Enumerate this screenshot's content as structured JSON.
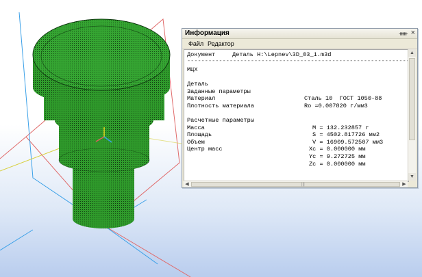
{
  "window": {
    "title": "Информация",
    "pin_icon": "pin-icon",
    "close_icon": "close-icon"
  },
  "menu": {
    "file": "Файл",
    "edit": "Редактор"
  },
  "document": {
    "label": "Документ",
    "value": "Деталь H:\\Lepnev\\3D_03_1.m3d",
    "separator": "------------------------------------------------------------------"
  },
  "section_mch": "МЦХ",
  "part": {
    "heading": "Деталь",
    "given_params": "Заданные параметры",
    "material_label": "Материал",
    "material_value": "Сталь 10  ГОСТ 1050-88",
    "density_label": "Плотность материала",
    "density_value": "Ro =0.007820 г/мм3"
  },
  "calc": {
    "heading": "Расчетные параметры",
    "mass_label": "Масса",
    "mass_value": "M = 132.232857 г",
    "area_label": "Площадь",
    "area_value": "S = 4502.817726 мм2",
    "volume_label": "Объем",
    "volume_value": "V = 16909.572507 мм3",
    "center_label": "Центр масс",
    "xc_value": "Xc = 0.000000 мм",
    "yc_value": "Yc = 9.272725 мм",
    "zc_value": "Zc = 0.000000 мм"
  },
  "colors": {
    "part_green": "#2e9e2a",
    "plane_red": "#e06060",
    "plane_blue": "#3aa0e8",
    "axis_yellow": "#e8e020"
  }
}
